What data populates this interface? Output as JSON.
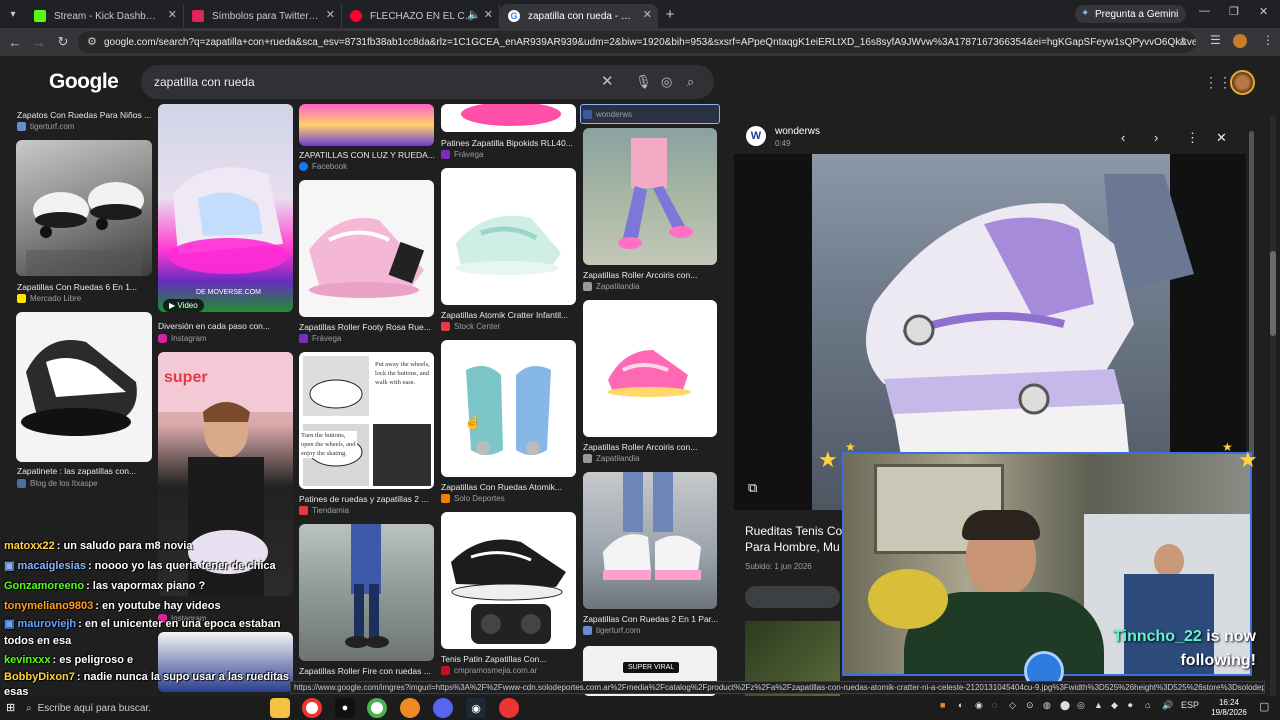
{
  "browser": {
    "tabs": [
      {
        "label": "Stream - Kick Dashboard",
        "color": "#53fc18"
      },
      {
        "label": "Símbolos para Twitter: signos, l",
        "color": "#e0245e"
      },
      {
        "label": "FLECHAZO EN EL CENTRO",
        "color": "#ff0033"
      },
      {
        "label": "zapatilla con rueda - Buscar con",
        "color": "#4285f4",
        "active": true
      }
    ],
    "gemini_label": "Pregunta a Gemini",
    "url": "google.com/search?q=zapatilla+con+rueda&sca_esv=8731fb38ab1cc8da&rlz=1C1GCEA_enAR939AR939&udm=2&biw=1920&bih=953&sxsrf=APpeQntaqgK1eiERLtXD_16s8syfA9JWvw%3A1787167366354&ei=hgKGapSFeyw1sQPyvvO6Qk&ved=0ahUKEw..."
  },
  "search": {
    "logo": "Google",
    "query": "zapatilla con rueda"
  },
  "results": {
    "col1": [
      {
        "title": "Zapatos Con Ruedas Para Niños ...",
        "source": "tigerturf.com",
        "src_color": "#6b8bd6"
      },
      {
        "title": "Zapatillas Con Ruedas 6 En 1...",
        "source": "Mercado Libre",
        "src_color": "#ffe600"
      },
      {
        "title": "Zapatinete : las zapatillas con...",
        "source": "Blog de los Itxaspe",
        "src_color": "#4a6fa5"
      }
    ],
    "col2": [
      {
        "title": "Diversión en cada paso con...",
        "source": "Instagram",
        "src_color": "#d6249f",
        "badge": "Video"
      },
      {
        "title": "",
        "source": "Instagram",
        "src_color": "#d6249f"
      }
    ],
    "col3": [
      {
        "title": "ZAPATILLAS CON LUZ Y RUEDA...",
        "source": "Facebook",
        "src_color": "#1877f2"
      },
      {
        "title": "Zapatillas Roller Footy Rosa Rue...",
        "source": "Frávega",
        "src_color": "#7b2cbf"
      },
      {
        "title": "Patines de ruedas y zapatillas 2 ...",
        "source": "Tiendamia",
        "src_color": "#e63946"
      },
      {
        "title": "Zapatillas Roller Fire con ruedas ...",
        "source": "",
        "src_color": "#888"
      }
    ],
    "col4": [
      {
        "title": "Patines Zapatilla Bipokids RLL40...",
        "source": "Frávega",
        "src_color": "#7b2cbf"
      },
      {
        "title": "Zapatillas Atomik Cratter Infantil...",
        "source": "Stock Center",
        "src_color": "#e63946"
      },
      {
        "title": "Zapatillas Con Ruedas Atomik...",
        "source": "Solo Deportes",
        "src_color": "#f77f00"
      },
      {
        "title": "Tenis Patin Zapatillas Con...",
        "source": "cmpramosmejia.com.ar",
        "src_color": "#c1121f"
      }
    ],
    "col5": [
      {
        "title": "",
        "source": "wonderws",
        "src_color": "#3d5a98"
      },
      {
        "title": "Zapatillas Roller Arcoiris con...",
        "source": "Zapatilandia",
        "src_color": "#999"
      },
      {
        "title": "Zapatillas Roller Arcoiris con...",
        "source": "Zapatilandia",
        "src_color": "#999"
      },
      {
        "title": "Zapatillas Con Ruedas 2 En 1 Par...",
        "source": "tigerturf.com",
        "src_color": "#6b8bd6"
      }
    ],
    "overlay_text": {
      "img2_text": "DE MOVERSE.COM",
      "instruction1": "Put away the wheels, lock the buttons, and walk with ease.",
      "instruction2": "Turn the buttons, open the wheels, and enjoy the skating.",
      "super_viral": "SUPER VIRAL",
      "super": "super"
    }
  },
  "panel": {
    "source": "wonderws",
    "duration": "0:49",
    "title_line1": "Rueditas Tenis Co",
    "title_line2": "Para Hombre, Mu",
    "uploaded": "Subido: 1 jun 2026"
  },
  "chat": [
    {
      "user": "matoxx22",
      "msg": ": un saludo para m8 novia",
      "color": "#ffd23f"
    },
    {
      "user": "macaiglesias",
      "msg": ": noooo yo las queria tener de chica",
      "color": "#8ab4f8"
    },
    {
      "user": "Gonzamoreeno",
      "msg": ": las vapormax piano ?",
      "color": "#53fc18"
    },
    {
      "user": "tonymeliano9803",
      "msg": ": en youtube hay videos",
      "color": "#ff9f1c"
    },
    {
      "user": "mauroviejh",
      "msg": ": en el unicenter en una epoca estaban todos en esa",
      "color": "#63a4ff"
    },
    {
      "user": "kevinxxx",
      "msg": ": es peligroso e",
      "color": "#53fc18"
    },
    {
      "user": "BobbyDixon7",
      "msg": ": nadie nunca la supo usar a las rueditas esas",
      "color": "#ffd23f"
    }
  ],
  "stream": {
    "follower": "Tinncho_22",
    "follow_text": "is now following!"
  },
  "statusbar": {
    "url": "https://www.google.com/imgres?imgurl=https%3A%2F%2Fwww-cdn.solodeportes.com.ar%2Fmedia%2Fcatalog%2Fproduct%2Fz%2Fa%2Fzapatillas-con-ruedas-atomik-cratter-ni-a-celeste-2120131045404cu-9.jpg%3Fwidth%3D525%26height%3D525%26store%3Dsolodeportes%26image-type%3Dimage&imgrefurl=https%3A%2F"
  },
  "taskbar": {
    "search_placeholder": "Escribe aquí para buscar.",
    "lang": "ESP",
    "time": "16:24",
    "date": "19/8/2026"
  }
}
